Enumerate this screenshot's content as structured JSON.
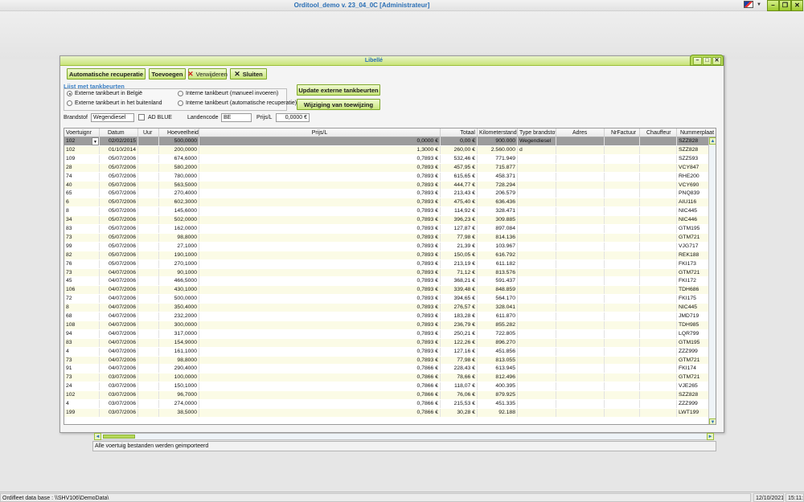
{
  "app": {
    "title": "Orditool_demo v. 23_04_0C [Administrateur]"
  },
  "window": {
    "title": "Libellé"
  },
  "toolbar": {
    "auto_recup": "Automatische recuperatie",
    "add": "Toevoegen",
    "delete": "Verwijderen",
    "close": "Sluiten",
    "update_ext": "Update externe tankbeurten",
    "change_ref": "Wijziging van toewijzing"
  },
  "list": {
    "title": "Lijst met tankbeurten",
    "radios": [
      {
        "label": "Externe tankbeurt in België",
        "checked": true
      },
      {
        "label": "Externe tankbeurt in het buitenland",
        "checked": false
      },
      {
        "label": "Interne tankbeurt (manueel invoeren)",
        "checked": false
      },
      {
        "label": "Interne tankbeurt (automatische recuperatie)",
        "checked": false
      }
    ]
  },
  "filters": {
    "brandstof_label": "Brandstof",
    "brandstof_value": "Wegendiesel",
    "adblue_label": "AD BLUE",
    "landencode_label": "Landencode",
    "landencode_value": "BE",
    "prijs_label": "Prijs/L",
    "prijs_value": "0,0000 €"
  },
  "grid": {
    "columns": [
      "Voertuignr",
      "Datum",
      "Uur",
      "Hoeveelheid",
      "Prijs/L",
      "Totaal",
      "Kilometerstand",
      "Type brandstof",
      "Adres",
      "NrFactuur",
      "Chauffeur",
      "Nummerplaat"
    ],
    "rows": [
      [
        "102",
        "02/02/2015",
        "",
        "500,0000",
        "0,0000 €",
        "0,00 €",
        "900.000",
        "Wegendiesel",
        "SZZ828"
      ],
      [
        "102",
        "01/10/2014",
        "",
        "200,0000",
        "1,3000 €",
        "260,00 €",
        "2.560.000",
        "d",
        "SZZ828"
      ],
      [
        "109",
        "05/07/2006",
        "",
        "674,6000",
        "0,7893 €",
        "532,46 €",
        "771.949",
        "",
        "SZZ593"
      ],
      [
        "28",
        "05/07/2006",
        "",
        "580,2000",
        "0,7893 €",
        "457,95 €",
        "715.877",
        "",
        "VCY847"
      ],
      [
        "74",
        "05/07/2006",
        "",
        "780,0000",
        "0,7893 €",
        "615,65 €",
        "458.371",
        "",
        "RHE200"
      ],
      [
        "40",
        "05/07/2006",
        "",
        "563,5000",
        "0,7893 €",
        "444,77 €",
        "728.294",
        "",
        "VCY690"
      ],
      [
        "65",
        "05/07/2006",
        "",
        "270,4000",
        "0,7893 €",
        "213,43 €",
        "206.579",
        "",
        "PNQ839"
      ],
      [
        "6",
        "05/07/2006",
        "",
        "602,3000",
        "0,7893 €",
        "475,40 €",
        "636.436",
        "",
        "AIU116"
      ],
      [
        "8",
        "05/07/2006",
        "",
        "145,6000",
        "0,7893 €",
        "114,92 €",
        "328.471",
        "",
        "NIC445"
      ],
      [
        "34",
        "05/07/2006",
        "",
        "502,0000",
        "0,7893 €",
        "396,23 €",
        "309.885",
        "",
        "NIC446"
      ],
      [
        "83",
        "05/07/2006",
        "",
        "162,0000",
        "0,7893 €",
        "127,87 €",
        "897.084",
        "",
        "GTM195"
      ],
      [
        "73",
        "05/07/2006",
        "",
        "98,8000",
        "0,7893 €",
        "77,98 €",
        "814.136",
        "",
        "GTM721"
      ],
      [
        "99",
        "05/07/2006",
        "",
        "27,1000",
        "0,7893 €",
        "21,39 €",
        "103.967",
        "",
        "VJG717"
      ],
      [
        "82",
        "05/07/2006",
        "",
        "190,1000",
        "0,7893 €",
        "150,05 €",
        "616.792",
        "",
        "REK188"
      ],
      [
        "76",
        "05/07/2006",
        "",
        "270,1000",
        "0,7893 €",
        "213,19 €",
        "611.182",
        "",
        "FKI173"
      ],
      [
        "73",
        "04/07/2006",
        "",
        "90,1000",
        "0,7893 €",
        "71,12 €",
        "813.576",
        "",
        "GTM721"
      ],
      [
        "45",
        "04/07/2006",
        "",
        "466,5000",
        "0,7893 €",
        "368,21 €",
        "591.437",
        "",
        "FKI172"
      ],
      [
        "106",
        "04/07/2006",
        "",
        "430,1000",
        "0,7893 €",
        "339,48 €",
        "848.859",
        "",
        "TDH686"
      ],
      [
        "72",
        "04/07/2006",
        "",
        "500,0000",
        "0,7893 €",
        "394,65 €",
        "564.170",
        "",
        "FKI175"
      ],
      [
        "8",
        "04/07/2006",
        "",
        "350,4000",
        "0,7893 €",
        "276,57 €",
        "328.041",
        "",
        "NIC445"
      ],
      [
        "68",
        "04/07/2006",
        "",
        "232,2000",
        "0,7893 €",
        "183,28 €",
        "611.870",
        "",
        "JMD719"
      ],
      [
        "108",
        "04/07/2006",
        "",
        "300,0000",
        "0,7893 €",
        "236,79 €",
        "855.282",
        "",
        "TDH985"
      ],
      [
        "94",
        "04/07/2006",
        "",
        "317,0000",
        "0,7893 €",
        "250,21 €",
        "722.805",
        "",
        "LQR799"
      ],
      [
        "83",
        "04/07/2006",
        "",
        "154,9000",
        "0,7893 €",
        "122,26 €",
        "896.270",
        "",
        "GTM195"
      ],
      [
        "4",
        "04/07/2006",
        "",
        "161,1000",
        "0,7893 €",
        "127,16 €",
        "451.856",
        "",
        "ZZZ999"
      ],
      [
        "73",
        "04/07/2006",
        "",
        "98,8000",
        "0,7893 €",
        "77,98 €",
        "813.055",
        "",
        "GTM721"
      ],
      [
        "91",
        "04/07/2006",
        "",
        "290,4000",
        "0,7866 €",
        "228,43 €",
        "613.945",
        "",
        "FKI174"
      ],
      [
        "73",
        "03/07/2006",
        "",
        "100,0000",
        "0,7866 €",
        "78,66 €",
        "812.496",
        "",
        "GTM721"
      ],
      [
        "24",
        "03/07/2006",
        "",
        "150,1000",
        "0,7866 €",
        "118,07 €",
        "400.395",
        "",
        "VJE265"
      ],
      [
        "102",
        "03/07/2006",
        "",
        "96,7000",
        "0,7866 €",
        "76,06 €",
        "879.925",
        "",
        "SZZ828"
      ],
      [
        "4",
        "03/07/2006",
        "",
        "274,0000",
        "0,7866 €",
        "215,53 €",
        "451.335",
        "",
        "ZZZ999"
      ],
      [
        "199",
        "03/07/2006",
        "",
        "38,5000",
        "0,7866 €",
        "30,28 €",
        "92.188",
        "",
        "LWT199"
      ]
    ]
  },
  "message": "Alle voertuig bestanden werden geimporteerd",
  "status": {
    "db": "Ordifleet data base : \\\\SHV106\\DemoData\\",
    "date": "12/10/2021",
    "time": "15:11:0"
  },
  "colors": {
    "accent_green": "#c8e57a",
    "title_blue": "#2a6fb5",
    "row_alt": "#fbfbe6",
    "row_selected": "#9c9c9c"
  }
}
